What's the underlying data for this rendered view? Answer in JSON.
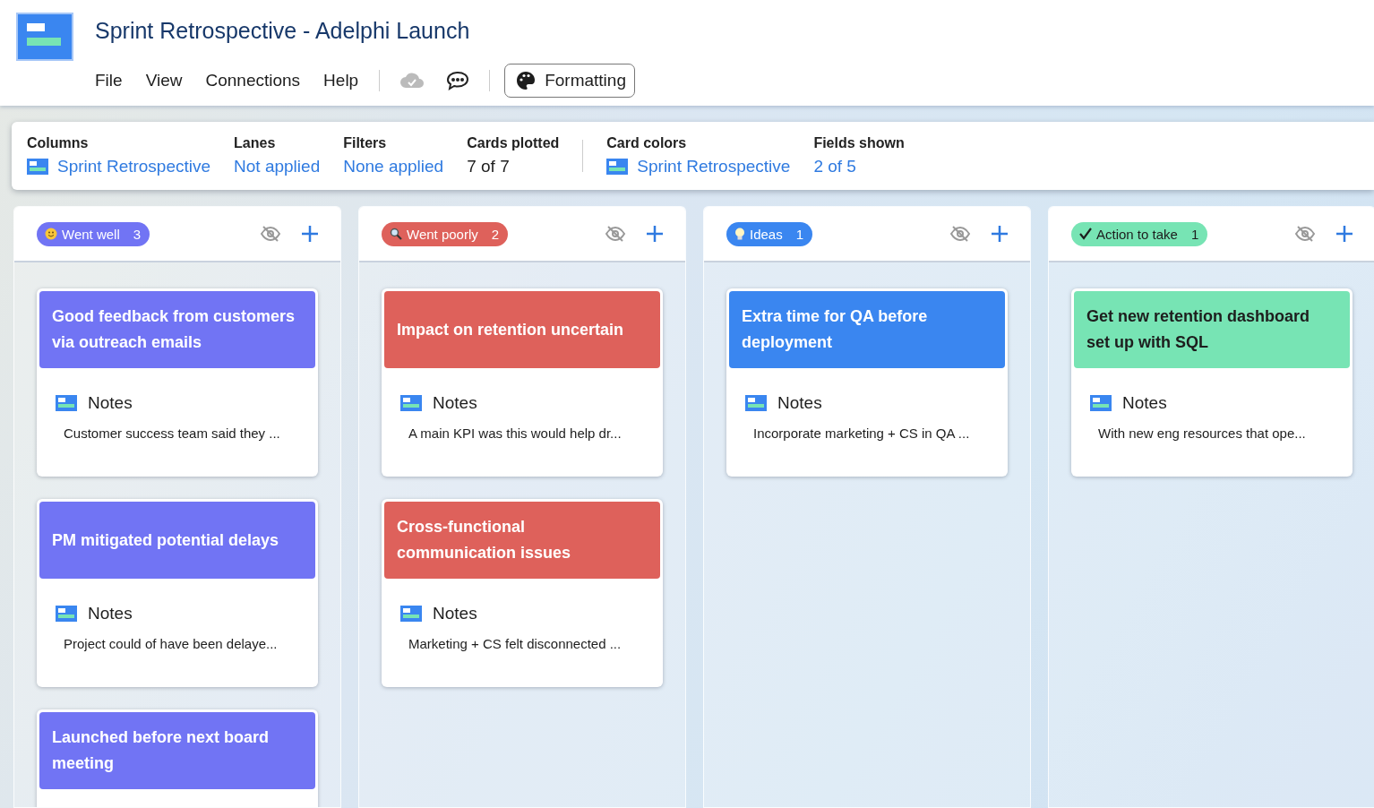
{
  "document": {
    "title": "Sprint Retrospective - Adelphi Launch"
  },
  "menu": [
    "File",
    "View",
    "Connections",
    "Help"
  ],
  "formatting_button": "Formatting",
  "summary": [
    {
      "label": "Columns",
      "value": "Sprint Retrospective",
      "kind": "link-icon"
    },
    {
      "label": "Lanes",
      "value": "Not applied",
      "kind": "link"
    },
    {
      "label": "Filters",
      "value": "None applied",
      "kind": "link"
    },
    {
      "label": "Cards plotted",
      "value": "7 of 7",
      "kind": "plain"
    },
    {
      "label": "Card colors",
      "value": "Sprint Retrospective",
      "kind": "link-icon"
    },
    {
      "label": "Fields shown",
      "value": "2 of 5",
      "kind": "link"
    }
  ],
  "columns": [
    {
      "name": "Went well",
      "count": "3",
      "kind": "smile",
      "color": "#7174f4",
      "cards": [
        {
          "title": "Good feedback from customers via outreach emails",
          "field": "Notes",
          "note": "Customer success team said they ..."
        },
        {
          "title": "PM mitigated potential delays",
          "field": "Notes",
          "note": "Project could of have been delaye..."
        },
        {
          "title": "Launched before next board meeting"
        }
      ]
    },
    {
      "name": "Went poorly",
      "count": "2",
      "kind": "magnifier",
      "color": "#de615b",
      "cards": [
        {
          "title": "Impact on retention uncertain",
          "field": "Notes",
          "note": "A main KPI was this would help dr..."
        },
        {
          "title": "Cross-functional communication issues",
          "field": "Notes",
          "note": "Marketing + CS felt disconnected ..."
        }
      ]
    },
    {
      "name": "Ideas",
      "count": "1",
      "kind": "bulb",
      "color": "#3a86f0",
      "cards": [
        {
          "title": "Extra time for QA before deployment",
          "field": "Notes",
          "note": "Incorporate marketing + CS in QA ..."
        }
      ]
    },
    {
      "name": "Action to take",
      "count": "1",
      "kind": "check",
      "color": "#77e4b4",
      "cards": [
        {
          "title": "Get new retention dashboard set up with SQL",
          "field": "Notes",
          "note": "With new eng resources that ope..."
        }
      ]
    }
  ]
}
